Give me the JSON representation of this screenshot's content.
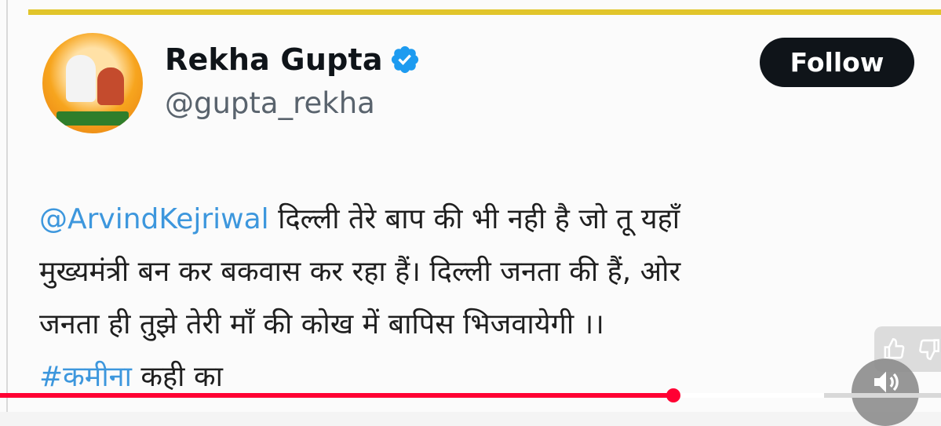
{
  "tweet": {
    "author_name": "Rekha Gupta",
    "author_handle": "@gupta_rekha",
    "follow_label": "Follow",
    "mention": "@ArvindKejriwal",
    "line1_rest": " दिल्ली तेरे बाप की भी नही है जो तू यहाँ",
    "line2": "मुख्यमंत्री बन कर बकवास कर रहा हैं। दिल्ली जनता की हैं, ओर",
    "line3": "जनता ही तुझे तेरी माँ की कोख में बापिस भिजवायेगी ।।",
    "hashtag": "#कमीना",
    "line4_rest": " कही का"
  },
  "video": {
    "progress_fraction": 0.716
  },
  "colors": {
    "accent": "#3d97dd",
    "progress": "#ff0033",
    "follow_bg": "#0f1419",
    "top_rule": "#e1c52b"
  },
  "icons": {
    "verified": "verified-badge-icon",
    "like": "thumbs-up-icon",
    "dislike": "thumbs-down-icon",
    "mute": "volume-icon"
  }
}
